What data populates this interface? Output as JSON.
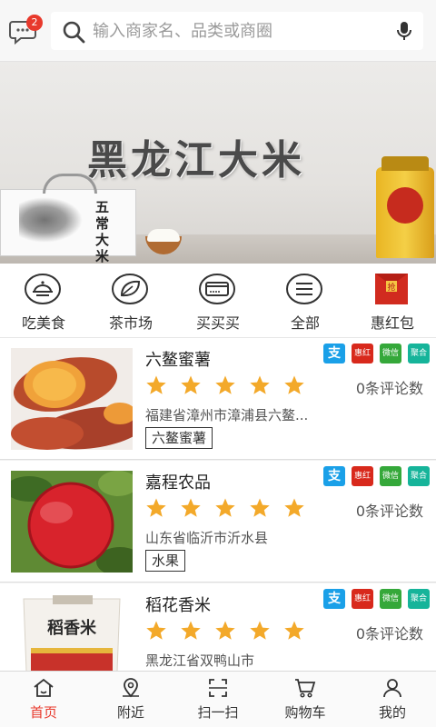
{
  "header": {
    "message_count": "2",
    "search_placeholder": "输入商家名、品类或商圈"
  },
  "banner": {
    "title": "黑龙江大米",
    "box_text": "五常大米",
    "slide_count": 3,
    "active_slide": 1
  },
  "categories": [
    {
      "label": "吃美食",
      "icon": "dining-icon"
    },
    {
      "label": "茶市场",
      "icon": "tea-leaf-icon"
    },
    {
      "label": "买买买",
      "icon": "card-icon"
    },
    {
      "label": "全部",
      "icon": "menu-icon"
    },
    {
      "label": "惠红包",
      "icon": "red-packet-icon",
      "icon_text": "抢"
    }
  ],
  "payment_badges": [
    {
      "label": "支",
      "color": "#1aa0e8"
    },
    {
      "label": "惠红包",
      "color": "#d8291c"
    },
    {
      "label": "微信",
      "color": "#35a83a"
    },
    {
      "label": "聚合",
      "color": "#16b49a"
    }
  ],
  "listings": [
    {
      "name": "六鳌蜜薯",
      "rating": 5,
      "reviews": "0条评论数",
      "address": "福建省漳州市漳浦县六鳌...",
      "tag": "六鳌蜜薯",
      "image": "sweet-potato"
    },
    {
      "name": "嘉程农品",
      "rating": 5,
      "reviews": "0条评论数",
      "address": "山东省临沂市沂水县",
      "tag": "水果",
      "image": "apple"
    },
    {
      "name": "稻花香米",
      "rating": 5,
      "reviews": "0条评论数",
      "address": "黑龙江省双鸭山市",
      "tag": "",
      "image": "rice-bag"
    }
  ],
  "bag_text": "稻香米",
  "tabbar": [
    {
      "label": "首页",
      "icon": "home-icon",
      "active": true
    },
    {
      "label": "附近",
      "icon": "location-icon",
      "active": false
    },
    {
      "label": "扫一扫",
      "icon": "scan-icon",
      "active": false
    },
    {
      "label": "购物车",
      "icon": "cart-icon",
      "active": false
    },
    {
      "label": "我的",
      "icon": "profile-icon",
      "active": false
    }
  ],
  "colors": {
    "accent": "#e8392c",
    "star": "#f3a92a"
  }
}
